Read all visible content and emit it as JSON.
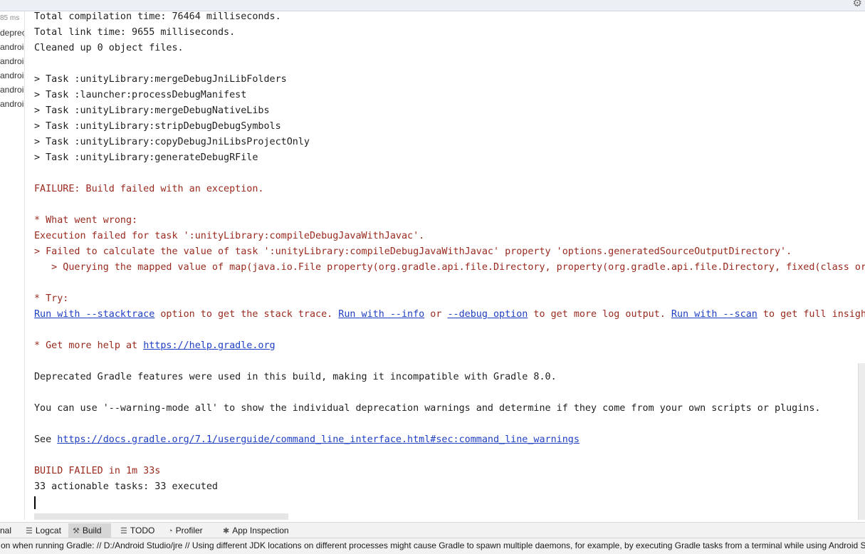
{
  "left_pane": {
    "items": [
      "85 ms",
      "deprec",
      "androi",
      "androi",
      "androi",
      "androi",
      "androi"
    ]
  },
  "console": {
    "lines": [
      {
        "text": "Total compilation time: 76464 milliseconds.",
        "kind": "normal"
      },
      {
        "text": "Total link time: 9655 milliseconds.",
        "kind": "normal"
      },
      {
        "text": "Cleaned up 0 object files.",
        "kind": "normal"
      },
      {
        "text": "> Task :unityLibrary:mergeDebugJniLibFolders",
        "kind": "normal"
      },
      {
        "text": "> Task :launcher:processDebugManifest",
        "kind": "normal"
      },
      {
        "text": "> Task :unityLibrary:mergeDebugNativeLibs",
        "kind": "normal"
      },
      {
        "text": "> Task :unityLibrary:stripDebugDebugSymbols",
        "kind": "normal"
      },
      {
        "text": "> Task :unityLibrary:copyDebugJniLibsProjectOnly",
        "kind": "normal"
      },
      {
        "text": "> Task :unityLibrary:generateDebugRFile",
        "kind": "normal"
      },
      {
        "text": "FAILURE: Build failed with an exception.",
        "kind": "error"
      },
      {
        "text": "* What went wrong:",
        "kind": "error"
      },
      {
        "text": "Execution failed for task ':unityLibrary:compileDebugJavaWithJavac'.",
        "kind": "error"
      },
      {
        "text": "> Failed to calculate the value of task ':unityLibrary:compileDebugJavaWithJavac' property 'options.generatedSourceOutputDirectory'.",
        "kind": "error"
      },
      {
        "text": "   > Querying the mapped value of map(java.io.File property(org.gradle.api.file.Directory, property(org.gradle.api.file.Directory, fixed(class org",
        "kind": "error"
      },
      {
        "text": "* Try:",
        "kind": "error"
      },
      {
        "text": "* Get more help at ",
        "kind": "error"
      },
      {
        "text": "Deprecated Gradle features were used in this build, making it incompatible with Gradle 8.0.",
        "kind": "normal"
      },
      {
        "text": "You can use '--warning-mode all' to show the individual deprecation warnings and determine if they come from your own scripts or plugins.",
        "kind": "normal"
      },
      {
        "text": "See ",
        "kind": "normal"
      },
      {
        "text": "BUILD FAILED in 1m 33s",
        "kind": "error"
      },
      {
        "text": "33 actionable tasks: 33 executed",
        "kind": "normal"
      }
    ],
    "try_line": {
      "link1": "Run with --stacktrace",
      "text1": " option to get the stack trace. ",
      "link2": "Run with --info",
      "text2": " or ",
      "link3": "--debug option",
      "text3": " to get more log output. ",
      "link4": "Run with --scan",
      "text4": " to get full insight"
    },
    "help_link": "https://help.gradle.org",
    "docs_link": "https://docs.gradle.org/7.1/userguide/command_line_interface.html#sec:command_line_warnings"
  },
  "tool_tabs": [
    {
      "label": "nal",
      "icon": ""
    },
    {
      "label": "Logcat",
      "icon": "logcat-icon"
    },
    {
      "label": "Build",
      "icon": "hammer-icon",
      "active": true
    },
    {
      "label": "TODO",
      "icon": "list-icon"
    },
    {
      "label": "Profiler",
      "icon": "gauge-icon"
    },
    {
      "label": "App Inspection",
      "icon": "bug-icon"
    }
  ],
  "status_bar": {
    "text": "on when running Gradle: // D:/Android Studio/jre // Using different JDK locations on different processes might cause Gradle to spawn multiple daemons, for example, by executing Gradle tasks from a terminal while using Android St"
  },
  "colors": {
    "error_text": "#9a2a1e",
    "link": "#1f3fc4",
    "active_tab": "#d6d6d6"
  }
}
